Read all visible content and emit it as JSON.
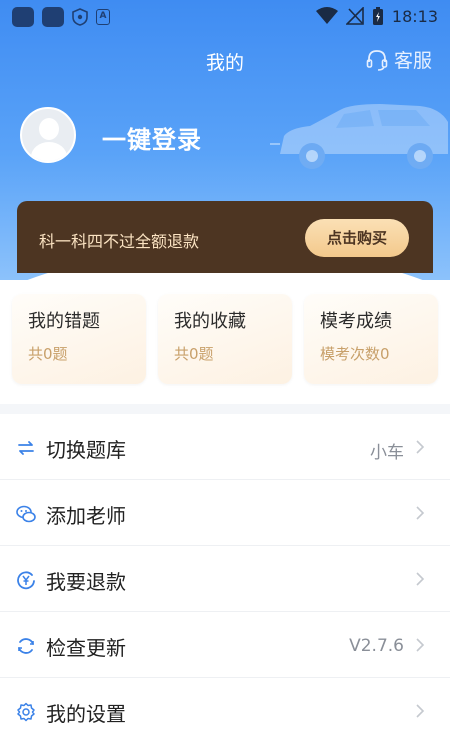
{
  "status_bar": {
    "time": "18:13",
    "app_label": "A"
  },
  "header": {
    "title": "我的",
    "service_label": "客服"
  },
  "profile": {
    "login_text": "一键登录"
  },
  "banner": {
    "text": "科一科四不过全额退款",
    "button_label": "点击购买"
  },
  "stats": [
    {
      "title": "我的错题",
      "subtitle": "共0题"
    },
    {
      "title": "我的收藏",
      "subtitle": "共0题"
    },
    {
      "title": "模考成绩",
      "subtitle": "模考次数0"
    }
  ],
  "menu": [
    {
      "label": "切换题库",
      "value": "小车",
      "icon": "swap-icon"
    },
    {
      "label": "添加老师",
      "value": "",
      "icon": "wechat-icon"
    },
    {
      "label": "我要退款",
      "value": "",
      "icon": "refund-icon"
    },
    {
      "label": "检查更新",
      "value": "V2.7.6",
      "icon": "update-icon"
    },
    {
      "label": "我的设置",
      "value": "",
      "icon": "settings-icon"
    }
  ],
  "colors": {
    "header_blue": "#3f8cf2",
    "banner_brown": "#4d3522",
    "button_gold": "#f3c98c",
    "icon_blue": "#3b82e8",
    "card_subtitle": "#c8a06a"
  }
}
